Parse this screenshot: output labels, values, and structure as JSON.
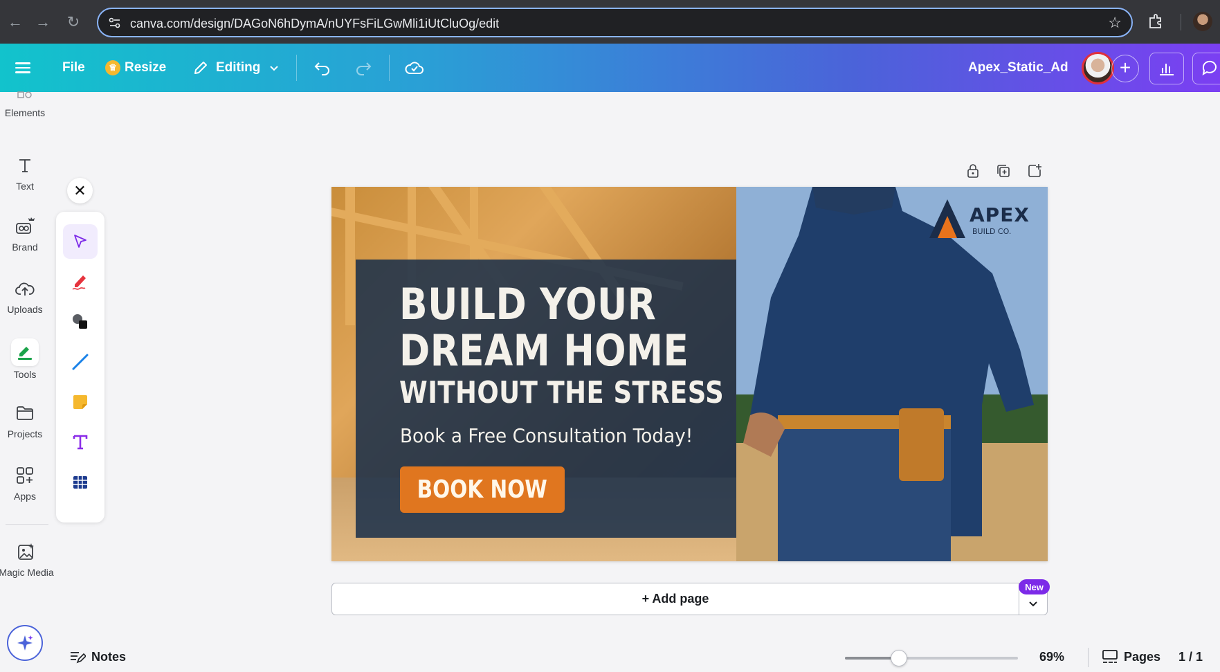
{
  "browser": {
    "url": "canva.com/design/DAGoN6hDymA/nUYFsFiLGwMli1iUtCluOg/edit"
  },
  "topbar": {
    "file_label": "File",
    "resize_label": "Resize",
    "editing_label": "Editing",
    "design_title": "Apex_Static_Ad"
  },
  "sidebar": {
    "items": [
      {
        "label": "Elements"
      },
      {
        "label": "Text"
      },
      {
        "label": "Brand"
      },
      {
        "label": "Uploads"
      },
      {
        "label": "Tools"
      },
      {
        "label": "Projects"
      },
      {
        "label": "Apps"
      },
      {
        "label": "Magic Media"
      }
    ]
  },
  "tools_palette": {
    "items": [
      "select",
      "draw",
      "shapes",
      "line",
      "sticky-note",
      "text",
      "table"
    ]
  },
  "design": {
    "headline_1": "BUILD YOUR",
    "headline_2": "DREAM HOME",
    "headline_3": "WITHOUT THE STRESS",
    "subline": "Book a Free Consultation Today!",
    "cta_label": "BOOK NOW",
    "logo_name": "APEX",
    "logo_sub": "BUILD CO."
  },
  "add_page": {
    "label": "+ Add page",
    "badge": "New"
  },
  "bottombar": {
    "notes_label": "Notes",
    "zoom_value": 69,
    "zoom_label": "69%",
    "pages_label": "Pages",
    "page_count": "1 / 1"
  },
  "colors": {
    "accent_gradient_start": "#12c3cc",
    "accent_gradient_end": "#7b3ff2",
    "cta_orange": "#e0761f",
    "panel_navy": "#182e4a",
    "new_badge": "#7c2ae8"
  }
}
